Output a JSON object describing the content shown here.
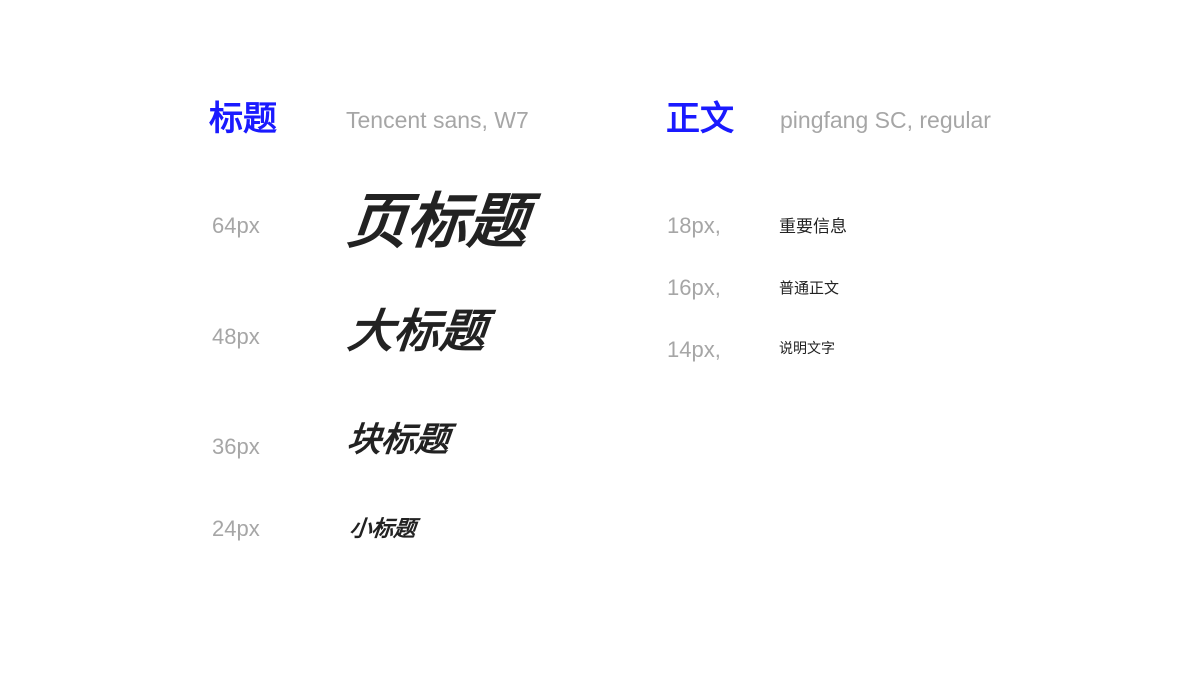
{
  "colors": {
    "accent": "#1a1aff",
    "label_gray": "#a6a6a6",
    "text_dark": "#222222",
    "background": "#ffffff"
  },
  "heading_section": {
    "title": "标题",
    "font_name": "Tencent sans, W7",
    "samples": [
      {
        "size_label": "64px",
        "text": "页标题"
      },
      {
        "size_label": "48px",
        "text": "大标题"
      },
      {
        "size_label": "36px",
        "text": "块标题"
      },
      {
        "size_label": "24px",
        "text": "小标题"
      }
    ]
  },
  "body_section": {
    "title": "正文",
    "font_name": "pingfang SC, regular",
    "samples": [
      {
        "size_label": "18px,",
        "text": "重要信息"
      },
      {
        "size_label": "16px,",
        "text": "普通正文"
      },
      {
        "size_label": "14px,",
        "text": "说明文字"
      }
    ]
  }
}
